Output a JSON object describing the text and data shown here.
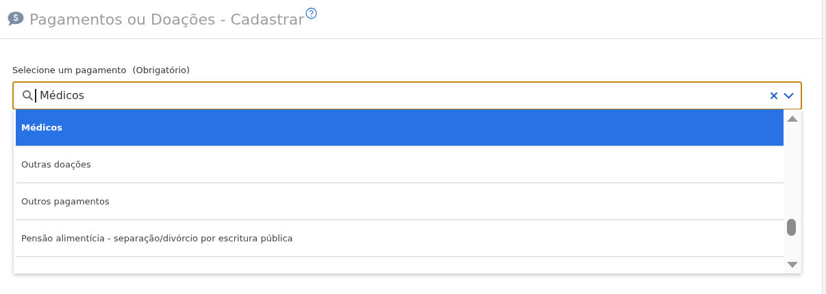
{
  "header": {
    "title": "Pagamentos ou Doações - Cadastrar"
  },
  "field": {
    "label": "Selecione um pagamento",
    "required_note": "(Obrigatório)",
    "value": "Médicos",
    "focused": true
  },
  "options": [
    {
      "label": "Médicos",
      "selected": true
    },
    {
      "label": "Outras doações",
      "selected": false
    },
    {
      "label": "Outros pagamentos",
      "selected": false
    },
    {
      "label": "Pensão alimentícia - separação/divórcio por escritura pública",
      "selected": false
    }
  ]
}
